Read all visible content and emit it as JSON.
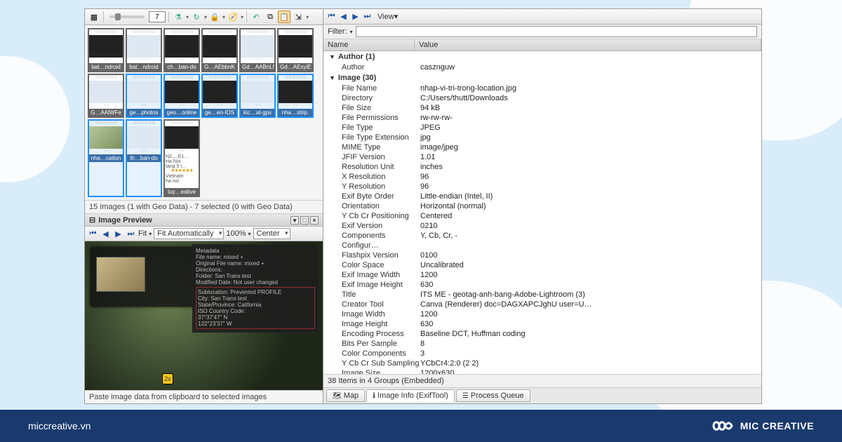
{
  "toolbar": {
    "zoom_value": "7"
  },
  "thumbs": [
    {
      "label": "bat…ndroid",
      "sel": false,
      "img": "dark"
    },
    {
      "label": "bat…ndroid",
      "sel": false,
      "img": "light"
    },
    {
      "label": "ch…ban-do",
      "sel": false,
      "img": "dark"
    },
    {
      "label": "G…AEbbnK",
      "sel": false,
      "img": "dark"
    },
    {
      "label": "Gd…AABnLf",
      "sel": false,
      "img": "light"
    },
    {
      "label": "Gd…AExyiE",
      "sel": false,
      "img": "dark"
    },
    {
      "label": "G…AAlWFe",
      "sel": false,
      "img": "light"
    },
    {
      "label": "ge…photos",
      "sel": true,
      "img": "light"
    },
    {
      "label": "geo…online",
      "sel": true,
      "img": "dark"
    },
    {
      "label": "ge…en-IOS",
      "sel": true,
      "img": "dark"
    },
    {
      "label": "kic…at-gps",
      "sel": true,
      "img": "light"
    },
    {
      "label": "nha…strip.",
      "sel": true,
      "img": "dark"
    },
    {
      "label": "nha…cation",
      "sel": true,
      "img": "map"
    },
    {
      "label": "th…ban-do",
      "sel": true,
      "img": "light"
    },
    {
      "label": "tuy…eative",
      "sel": false,
      "img": "dark",
      "meta": "N2…;E1…\nHa Noi\ntang 5 t…",
      "extra_stars": true,
      "meta2": "Vietnam\nha noi"
    }
  ],
  "grid_status": "15 Images (1 with Geo Data) - 7 selected (0 with Geo Data)",
  "preview": {
    "title": "Image Preview",
    "fit_label": "Fit",
    "fit_mode": "Fit Automatically",
    "zoom": "100%",
    "center": "Center",
    "marker": "2x",
    "meta_lines": [
      "Metadata",
      "File name: mixed +",
      "Original File name: mixed +",
      "Directions:",
      "Folder:  San Trans test",
      "Modified Date: Not user changed"
    ],
    "meta_hl": [
      "Sublocation: Prevented PROFILE",
      "City:  San Trans test",
      "State/Province: California",
      "ISO Country Code:",
      "   37°37'47\" N",
      "   122°23'37\" W"
    ]
  },
  "footer_left": "Paste image data from clipboard to selected images",
  "right_nav": {
    "view": "View"
  },
  "filter_label": "Filter:",
  "cols": {
    "name": "Name",
    "value": "Value"
  },
  "groups": [
    {
      "title": "Author (1)",
      "rows": [
        [
          "Author",
          "casznguw"
        ]
      ]
    },
    {
      "title": "Image (30)",
      "rows": [
        [
          "File Name",
          "nhap-vi-tri-trong-location.jpg"
        ],
        [
          "Directory",
          "C:/Users/thutt/Downloads"
        ],
        [
          "File Size",
          "94 kB"
        ],
        [
          "File Permissions",
          "rw-rw-rw-"
        ],
        [
          "File Type",
          "JPEG"
        ],
        [
          "File Type Extension",
          "jpg"
        ],
        [
          "MIME Type",
          "image/jpeg"
        ],
        [
          "JFIF Version",
          "1.01"
        ],
        [
          "Resolution Unit",
          "inches"
        ],
        [
          "X Resolution",
          "96"
        ],
        [
          "Y Resolution",
          "96"
        ],
        [
          "Exif Byte Order",
          "Little-endian (Intel, II)"
        ],
        [
          "Orientation",
          "Horizontal (normal)"
        ],
        [
          "Y Cb Cr Positioning",
          "Centered"
        ],
        [
          "Exif Version",
          "0210"
        ],
        [
          "Components Configur…",
          "Y, Cb, Cr, -"
        ],
        [
          "Flashpix Version",
          "0100"
        ],
        [
          "Color Space",
          "Uncalibrated"
        ],
        [
          "Exif Image Width",
          "1200"
        ],
        [
          "Exif Image Height",
          "630"
        ],
        [
          "Title",
          "ITS ME - geotag-anh-bang-Adobe-Lightroom (3)"
        ],
        [
          "Creator Tool",
          "Canva (Renderer) doc=DAGXAPCJghU user=U…"
        ],
        [
          "Image Width",
          "1200"
        ],
        [
          "Image Height",
          "630"
        ],
        [
          "Encoding Process",
          "Baseline DCT, Huffman coding"
        ],
        [
          "Bits Per Sample",
          "8"
        ],
        [
          "Color Components",
          "3"
        ],
        [
          "Y Cb Cr Sub Sampling",
          "YCbCr4:2:0 (2 2)"
        ],
        [
          "Image Size",
          "1200x630"
        ]
      ]
    }
  ],
  "right_status": "38 Items in 4 Groups   (Embedded)",
  "tabs": {
    "map": "Map",
    "info": "Image Info (ExifTool)",
    "queue": "Process Queue"
  },
  "brand": {
    "site": "miccreative.vn",
    "name": "MIC CREATIVE"
  }
}
